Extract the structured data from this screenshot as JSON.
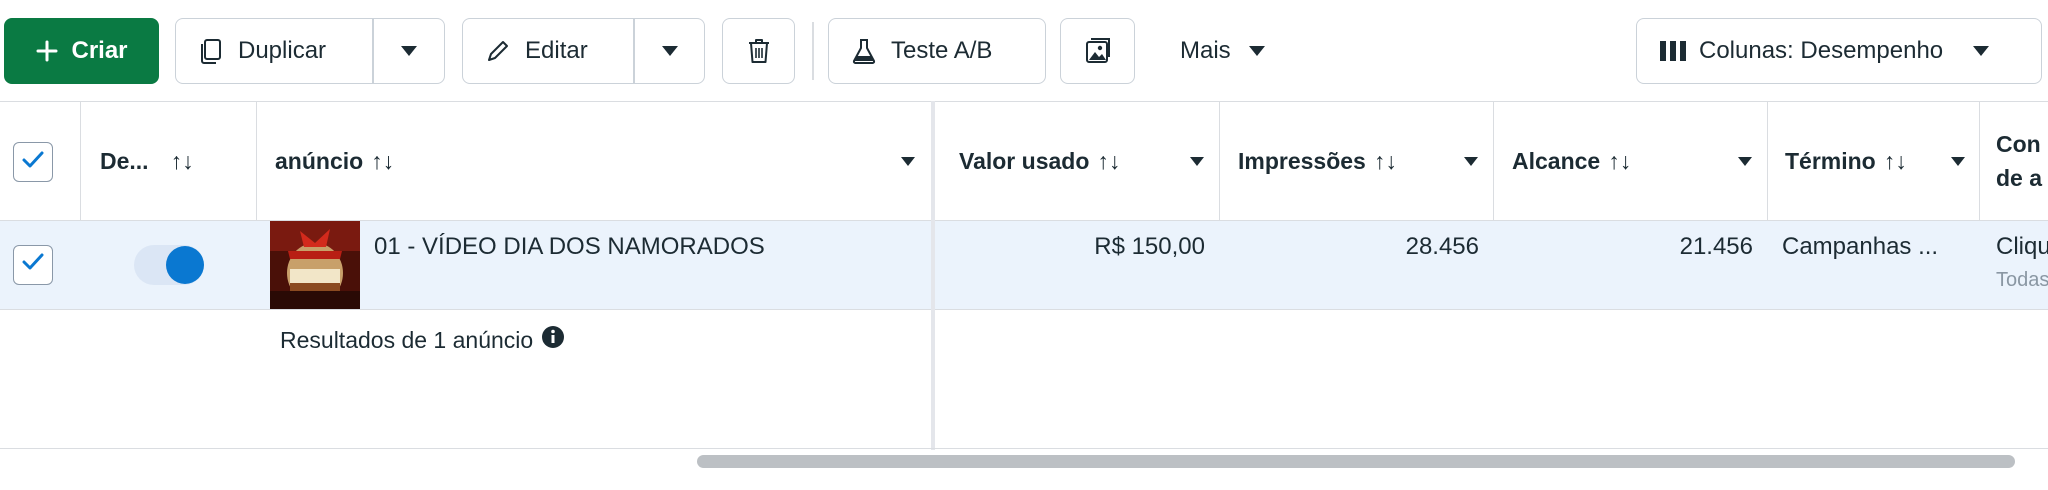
{
  "toolbar": {
    "create_label": "Criar",
    "duplicate_label": "Duplicar",
    "edit_label": "Editar",
    "ab_test_label": "Teste A/B",
    "more_label": "Mais",
    "columns_label": "Colunas: Desempenho"
  },
  "table": {
    "headers": {
      "delivery": "De...",
      "ad": "anúncio",
      "amount_spent": "Valor usado",
      "impressions": "Impressões",
      "reach": "Alcance",
      "ends": "Término",
      "last_line1": "Con",
      "last_line2": "de a"
    },
    "sort_glyph": "↑↓",
    "rows": [
      {
        "selected": true,
        "active": true,
        "name": "01 - VÍDEO DIA DOS NAMORADOS",
        "amount_spent": "R$ 150,00",
        "impressions": "28.456",
        "reach": "21.456",
        "ends": "Campanhas ...",
        "last_line1": "Cliqu",
        "last_line2": "Todas"
      }
    ],
    "footer": "Resultados de 1 anúncio"
  },
  "colors": {
    "primary": "#0a7a43",
    "row_selected_bg": "#ebf3fc",
    "toggle_on": "#0a78d1",
    "checkbox_check": "#0a78d1"
  },
  "icons": [
    "plus-icon",
    "duplicate-icon",
    "chevron-down-icon",
    "pencil-icon",
    "trash-icon",
    "flask-icon",
    "image-gallery-icon",
    "columns-icon",
    "sort-icon",
    "check-icon",
    "info-icon"
  ]
}
